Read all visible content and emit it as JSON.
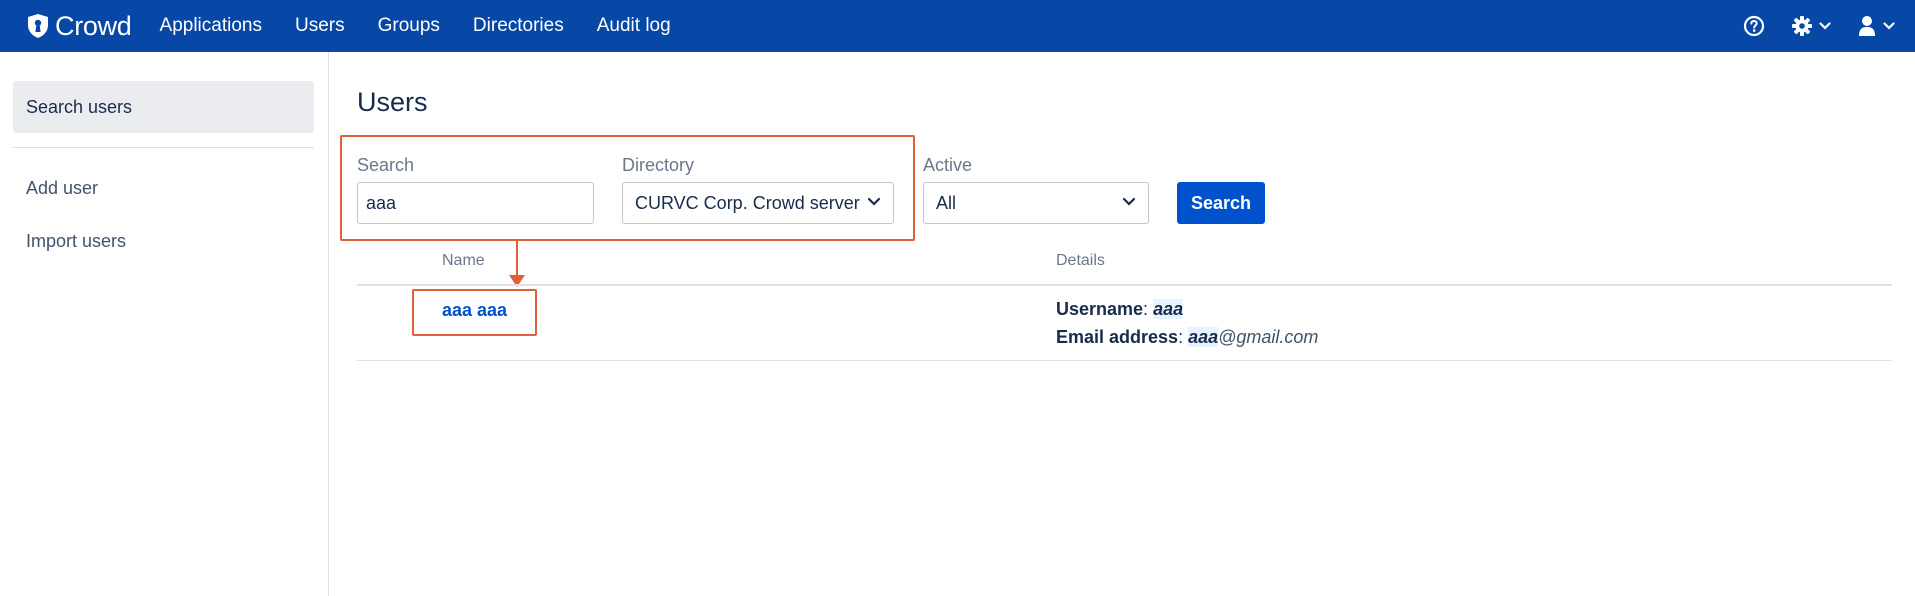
{
  "app": {
    "name": "Crowd"
  },
  "nav": {
    "items": [
      "Applications",
      "Users",
      "Groups",
      "Directories",
      "Audit log"
    ]
  },
  "topbar_icons": [
    "help-icon",
    "gear-icon",
    "user-icon"
  ],
  "colors": {
    "topbar": "#0747a6",
    "primary": "#0052cc",
    "annotation": "#e0603a"
  },
  "sidebar": {
    "active": "Search users",
    "items": [
      "Add user",
      "Import users"
    ]
  },
  "page": {
    "title": "Users"
  },
  "filters": {
    "search_label": "Search",
    "search_value": "aaa",
    "directory_label": "Directory",
    "directory_value": "CURVC Corp. Crowd server",
    "active_label": "Active",
    "active_value": "All",
    "search_button": "Search"
  },
  "table": {
    "columns": [
      "Name",
      "Details"
    ],
    "rows": [
      {
        "name": "aaa aaa",
        "username_label": "Username",
        "username": "aaa",
        "email_label": "Email address",
        "email_match": "aaa",
        "email_rest": "@gmail.com"
      }
    ]
  }
}
